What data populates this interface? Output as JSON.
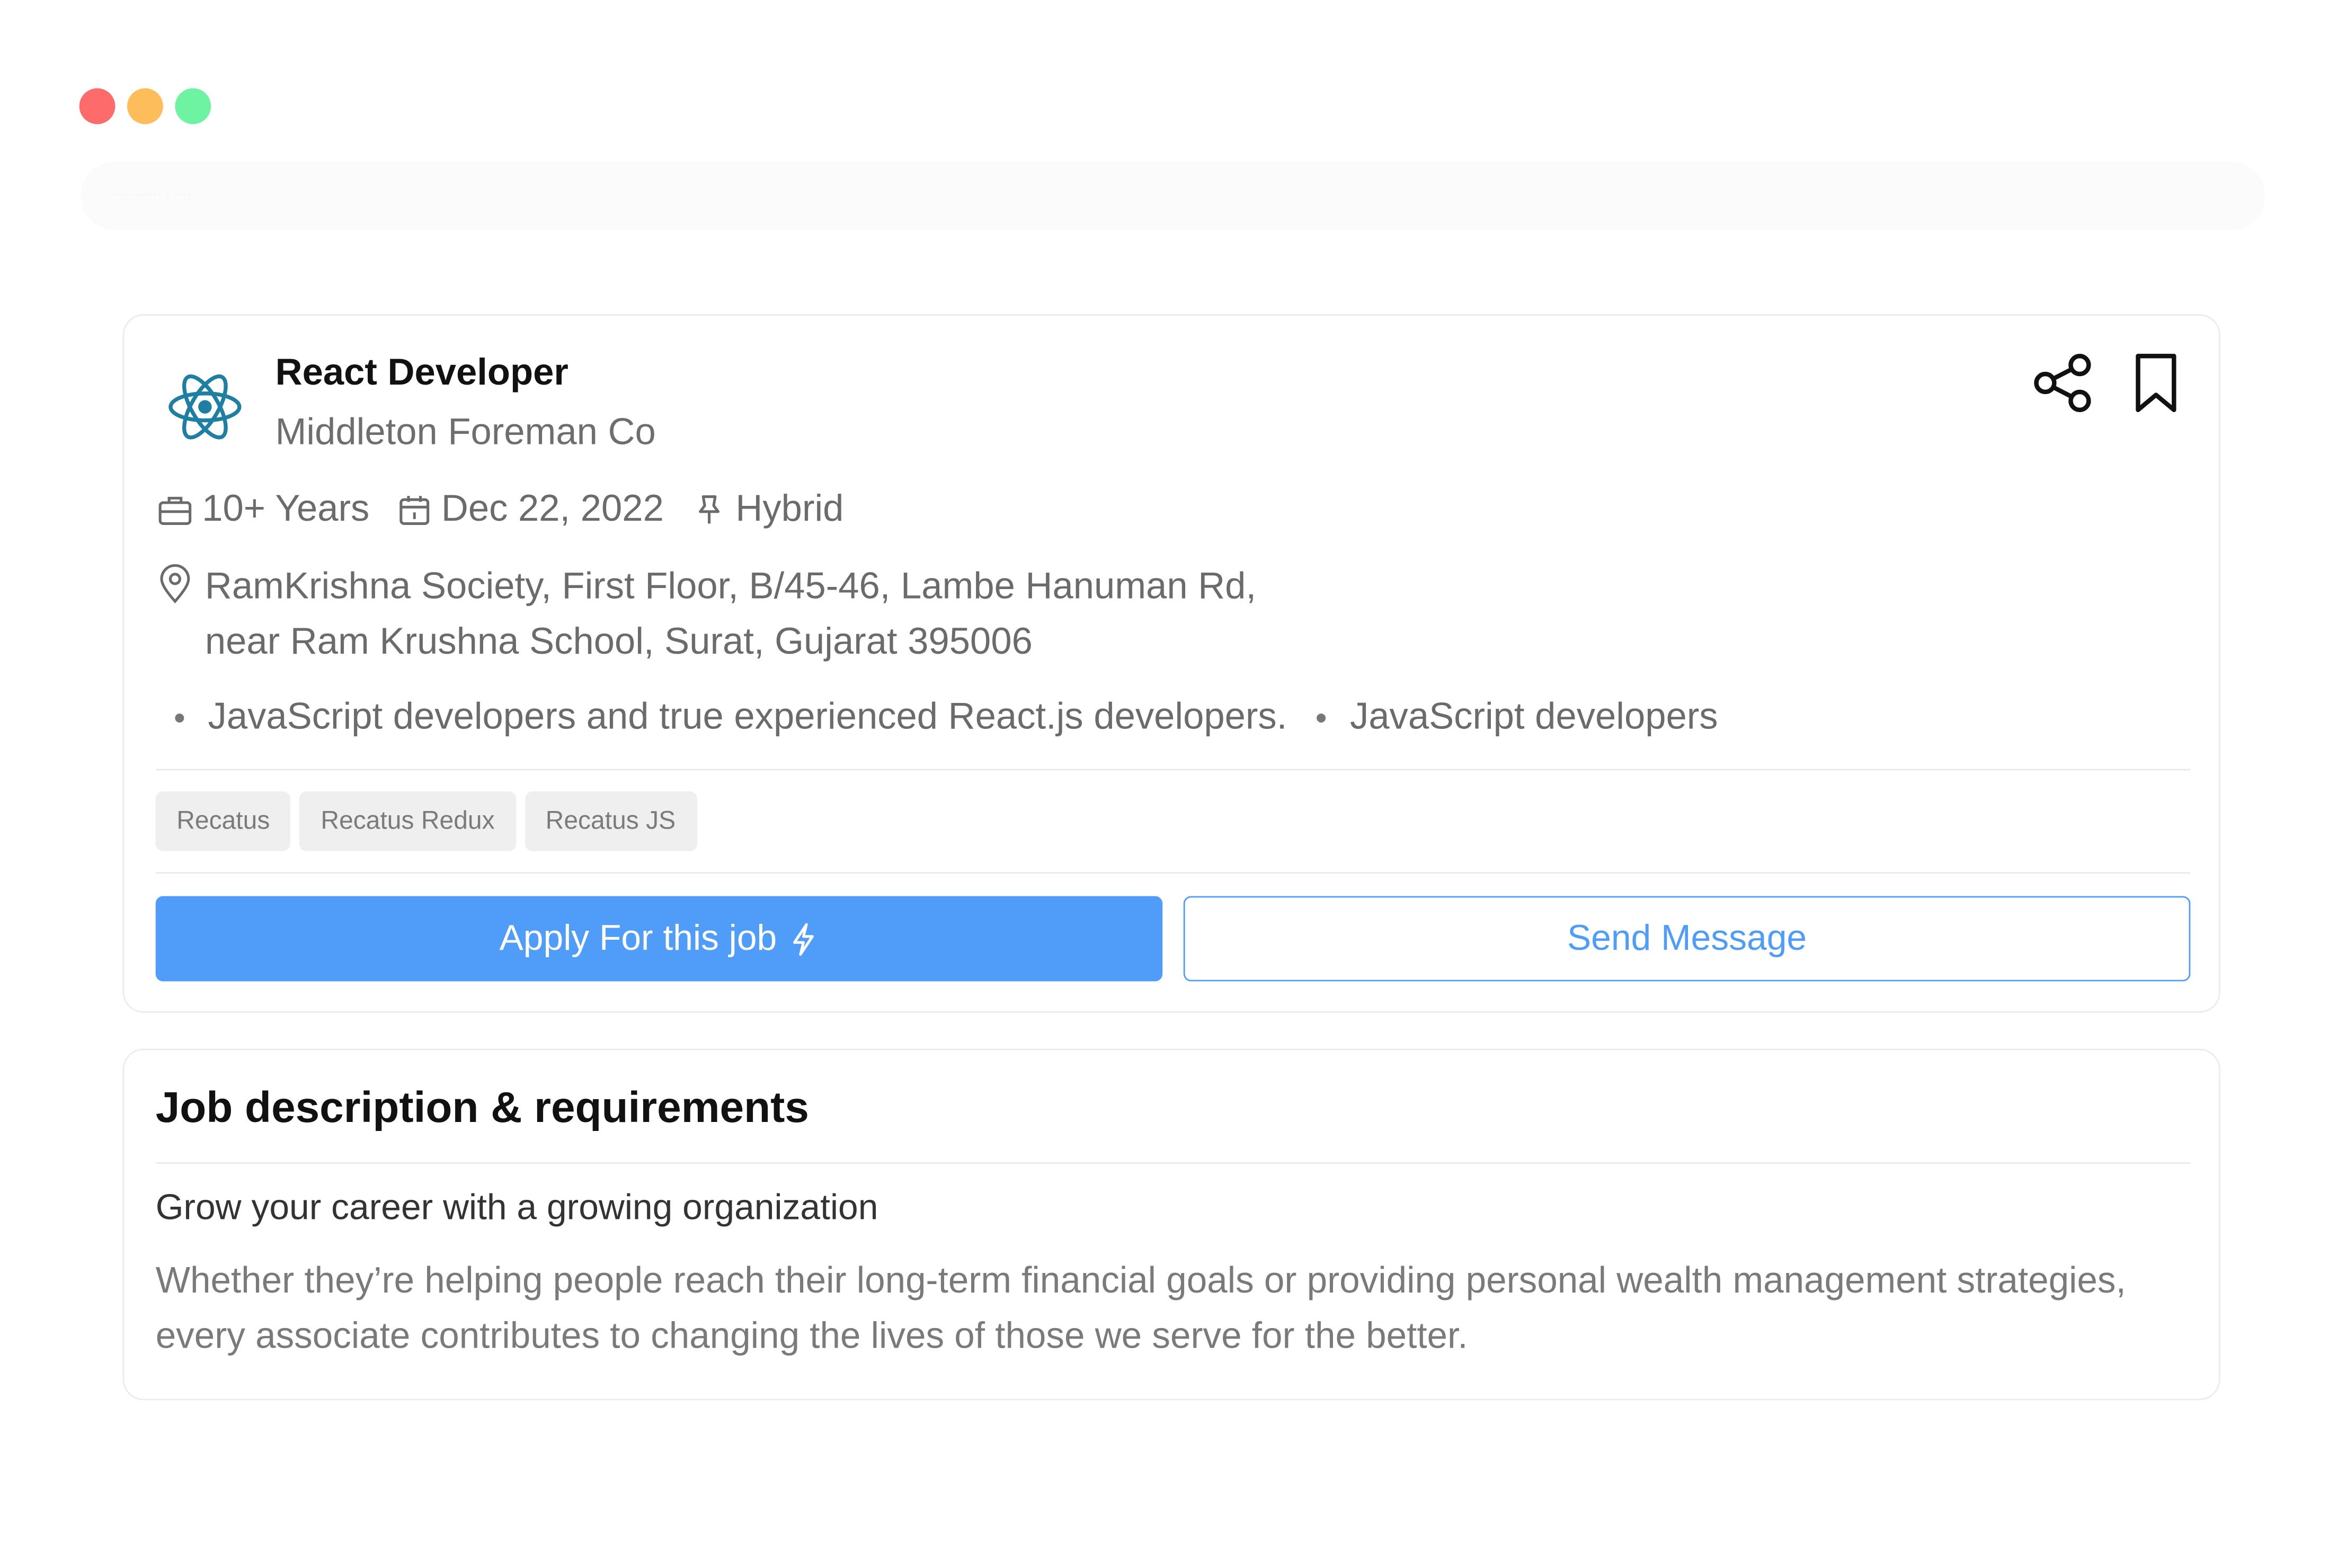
{
  "window": {
    "faint_text": "············ · ····"
  },
  "job": {
    "title": "React Developer",
    "company": "Middleton Foreman Co",
    "meta": {
      "experience": "10+ Years",
      "date": "Dec 22, 2022",
      "mode": "Hybrid"
    },
    "address": {
      "line1": "RamKrishna Society, First Floor, B/45-46, Lambe Hanuman Rd,",
      "line2": "near Ram Krushna School, Surat, Gujarat 395006"
    },
    "bullets": [
      "JavaScript developers and true experienced React.js developers.",
      "JavaScript developers"
    ],
    "tags": [
      "Recatus",
      "Recatus Redux",
      "Recatus JS"
    ],
    "apply_label": "Apply For this job",
    "message_label": "Send Message"
  },
  "description": {
    "title": "Job description & requirements",
    "subtitle": "Grow your career with a growing organization",
    "body": "Whether they’re helping people reach their long-term financial goals or providing personal wealth management strategies, every associate contributes to changing the lives of those we serve for the better."
  },
  "colors": {
    "accent": "#4f9cf9",
    "dot_red": "#fd6b6b",
    "dot_yellow": "#fdbd5a",
    "dot_green": "#6ef3a3",
    "react_logo": "#1f7fa3"
  },
  "icons": {
    "logo": "react-logo-icon",
    "share": "share-icon",
    "bookmark": "bookmark-icon",
    "experience": "briefcase-icon",
    "date": "calendar-icon",
    "mode": "pin-icon",
    "address": "location-icon",
    "apply": "lightning-icon"
  }
}
